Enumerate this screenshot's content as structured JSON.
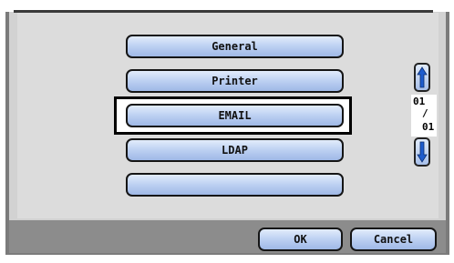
{
  "menu": {
    "items": [
      {
        "label": "General"
      },
      {
        "label": "Printer"
      },
      {
        "label": "EMAIL"
      },
      {
        "label": "LDAP"
      },
      {
        "label": ""
      }
    ],
    "selected_index": 2
  },
  "pager": {
    "current": "01",
    "separator": "/",
    "total": "01",
    "up_icon": "arrow-up-icon",
    "down_icon": "arrow-down-icon"
  },
  "footer": {
    "ok_label": "OK",
    "cancel_label": "Cancel"
  },
  "colors": {
    "panel": "#dcdcdc",
    "footer": "#8c8c8c",
    "button_top": "#e2ecfb",
    "button_bottom": "#9fb8e6",
    "arrow": "#1e5ccd"
  }
}
